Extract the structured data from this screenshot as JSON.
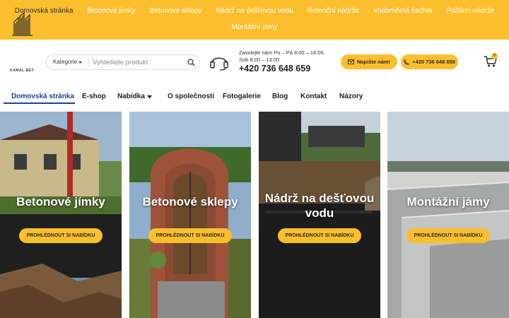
{
  "topnav": {
    "row1": [
      "Domovská stránka",
      "Betonové jímky",
      "Betonové sklepy",
      "Nádrž na dešťovou vodu",
      "Retenční nádrže",
      "Vodoměrná šachta",
      "Požární nádrže"
    ],
    "row2": [
      "Montážní jámy"
    ]
  },
  "header": {
    "logo_text": "KAMAL-BET",
    "search_category": "Kategorie",
    "search_placeholder": "Vyhledejte produkt",
    "hours": "Zavolejte nám Po – Pá 8:00 – 16:00, Sob 8:00 – 13:00",
    "phone": "+420 736 648 659",
    "btn_mail": "Napište nám!",
    "btn_phone": "+420 736 648 659",
    "cart_count": "0"
  },
  "mainnav": {
    "items": [
      "Domovská stránka",
      "E-shop",
      "Nabídka",
      "O společnosti",
      "Fotogalerie",
      "Blog",
      "Kontakt",
      "Názory"
    ]
  },
  "cards": [
    {
      "title": "Betonové jímky",
      "cta": "PROHLÉDNOUT SI NABÍDKU"
    },
    {
      "title": "Betonové sklepy",
      "cta": "PROHLÉDNOUT SI NABÍDKU"
    },
    {
      "title": "Nádrž na dešťovou vodu",
      "cta": "PROHLÉDNOUT SI NABÍDKU"
    },
    {
      "title": "Montážní jámy",
      "cta": "PROHLÉDNOUT SI NABÍDKU"
    }
  ],
  "colors": {
    "accent": "#fbbf2e",
    "nav_active": "#18468a"
  },
  "icons": [
    "logo-icon",
    "search-icon",
    "chevron-down-icon",
    "headset-icon",
    "mail-icon",
    "phone-icon",
    "cart-icon"
  ]
}
